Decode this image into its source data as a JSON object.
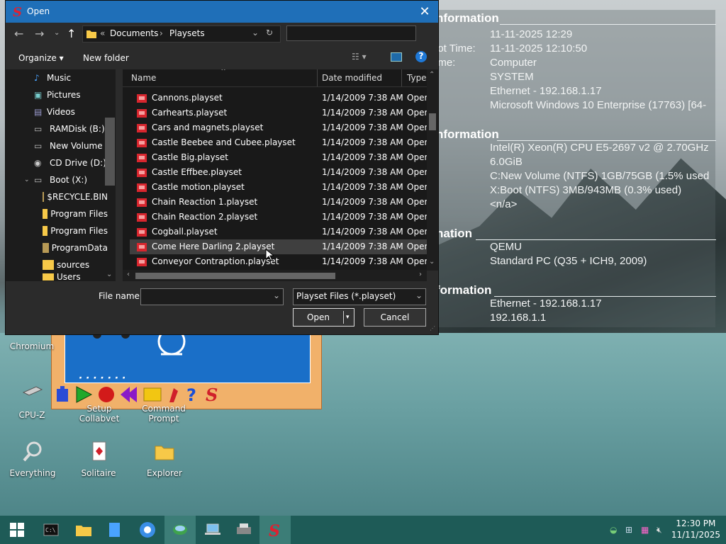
{
  "dialog": {
    "title": "Open",
    "breadcrumb": [
      "Documents",
      "Playsets"
    ],
    "search_placeholder": "",
    "toolbar": {
      "organize": "Organize",
      "new_folder": "New folder"
    },
    "nav_items": [
      {
        "label": "Music",
        "icon": "music-icon"
      },
      {
        "label": "Pictures",
        "icon": "pictures-icon"
      },
      {
        "label": "Videos",
        "icon": "videos-icon"
      },
      {
        "label": "RAMDisk (B:)",
        "icon": "drive-icon"
      },
      {
        "label": "New Volume (C",
        "icon": "drive-icon"
      },
      {
        "label": "CD Drive (D:) v",
        "icon": "cd-drive-icon"
      },
      {
        "label": "Boot (X:)",
        "icon": "drive-icon"
      },
      {
        "label": "$RECYCLE.BIN",
        "icon": "folder-icon"
      },
      {
        "label": "Program Files",
        "icon": "folder-icon"
      },
      {
        "label": "Program Files",
        "icon": "folder-icon"
      },
      {
        "label": "ProgramData",
        "icon": "folder-icon"
      },
      {
        "label": "sources",
        "icon": "folder-icon"
      },
      {
        "label": "Users",
        "icon": "folder-icon"
      }
    ],
    "columns": {
      "name": "Name",
      "date": "Date modified",
      "type": "Type"
    },
    "files": [
      {
        "name": "Cannons.playset",
        "date": "1/14/2009 7:38 AM",
        "type": "Open I"
      },
      {
        "name": "Carhearts.playset",
        "date": "1/14/2009 7:38 AM",
        "type": "Open I"
      },
      {
        "name": "Cars and magnets.playset",
        "date": "1/14/2009 7:38 AM",
        "type": "Open I"
      },
      {
        "name": "Castle Beebee and Cubee.playset",
        "date": "1/14/2009 7:38 AM",
        "type": "Open I"
      },
      {
        "name": "Castle Big.playset",
        "date": "1/14/2009 7:38 AM",
        "type": "Open I"
      },
      {
        "name": "Castle Effbee.playset",
        "date": "1/14/2009 7:38 AM",
        "type": "Open I"
      },
      {
        "name": "Castle motion.playset",
        "date": "1/14/2009 7:38 AM",
        "type": "Open I"
      },
      {
        "name": "Chain Reaction 1.playset",
        "date": "1/14/2009 7:38 AM",
        "type": "Open I"
      },
      {
        "name": "Chain Reaction 2.playset",
        "date": "1/14/2009 7:38 AM",
        "type": "Open I"
      },
      {
        "name": "Cogball.playset",
        "date": "1/14/2009 7:38 AM",
        "type": "Open I"
      },
      {
        "name": "Come Here Darling 2.playset",
        "date": "1/14/2009 7:38 AM",
        "type": "Open I"
      },
      {
        "name": "Conveyor Contraption.playset",
        "date": "1/14/2009 7:38 AM",
        "type": "Open I"
      }
    ],
    "selected_index": 10,
    "file_name_label": "File name:",
    "file_name_value": "",
    "filter": "Playset Files (*.playset)",
    "open_label": "Open",
    "cancel_label": "Cancel"
  },
  "info": {
    "sections": [
      "nformation",
      "nformation",
      "nation",
      "formation"
    ],
    "rows": [
      {
        "k": "",
        "v": "11-11-2025 12:29"
      },
      {
        "k": "oot Time:",
        "v": "11-11-2025 12:10:50"
      },
      {
        "k": "ame:",
        "v": "Computer"
      },
      {
        "k": "",
        "v": "SYSTEM"
      },
      {
        "k": "",
        "v": "Ethernet - 192.168.1.17"
      },
      {
        "k": "",
        "v": "Microsoft Windows 10 Enterprise (17763) [64-"
      },
      {
        "k": "",
        "v": "Intel(R) Xeon(R) CPU E5-2697 v2 @ 2.70GHz"
      },
      {
        "k": "",
        "v": "6.0GiB"
      },
      {
        "k": "",
        "v": "C:New Volume (NTFS) 1GB/75GB (1.5% used"
      },
      {
        "k": "",
        "v": "X:Boot (NTFS) 3MB/943MB (0.3% used)"
      },
      {
        "k": "",
        "v": "<n/a>"
      },
      {
        "k": "r:",
        "v": "QEMU"
      },
      {
        "k": "",
        "v": "Standard PC (Q35 + ICH9, 2009)"
      },
      {
        "k": "",
        "v": "Ethernet - 192.168.1.17"
      },
      {
        "k": "",
        "v": "192.168.1.1"
      }
    ]
  },
  "desktop_icons": [
    "Chromium",
    "CPU-Z",
    "Setup Collabvet",
    "Command Prompt",
    "Everything",
    "Solitaire",
    "Explorer"
  ],
  "taskbar": {
    "time": "12:30 PM",
    "date": "11/11/2025"
  },
  "colors": {
    "titlebar": "#1f6fb8",
    "taskbar": "#1e5b57",
    "accent": "#1f6fb8"
  }
}
